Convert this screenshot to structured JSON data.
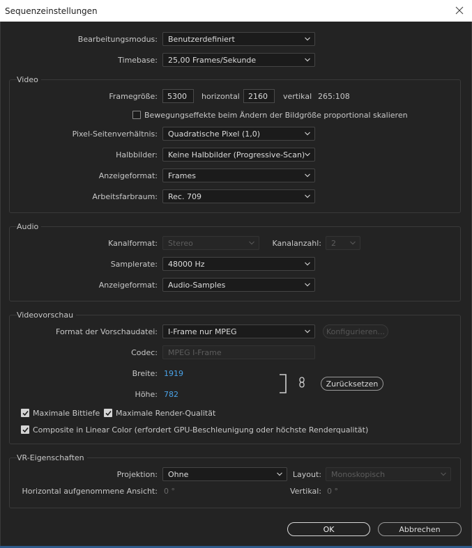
{
  "window": {
    "title": "Sequenzeinstellungen"
  },
  "general": {
    "editing_mode_label": "Bearbeitungsmodus:",
    "editing_mode_value": "Benutzerdefiniert",
    "timebase_label": "Timebase:",
    "timebase_value": "25,00  Frames/Sekunde"
  },
  "video": {
    "section_title": "Video",
    "frame_size_label": "Framegröße:",
    "frame_width": "5300",
    "horizontal_label": "horizontal",
    "frame_height": "2160",
    "vertical_label": "vertikal",
    "aspect_ratio": "265:108",
    "scale_checkbox_label": "Bewegungseffekte beim Ändern der Bildgröße proportional skalieren",
    "scale_checkbox_checked": false,
    "pixel_aspect_label": "Pixel-Seitenverhältnis:",
    "pixel_aspect_value": "Quadratische Pixel (1,0)",
    "fields_label": "Halbbilder:",
    "fields_value": "Keine Halbbilder (Progressive-Scan)",
    "display_format_label": "Anzeigeformat:",
    "display_format_value": "Frames",
    "working_color_label": "Arbeitsfarbraum:",
    "working_color_value": "Rec. 709"
  },
  "audio": {
    "section_title": "Audio",
    "channel_format_label": "Kanalformat:",
    "channel_format_value": "Stereo",
    "channel_count_label": "Kanalanzahl:",
    "channel_count_value": "2",
    "sample_rate_label": "Samplerate:",
    "sample_rate_value": "48000 Hz",
    "display_format_label": "Anzeigeformat:",
    "display_format_value": "Audio-Samples"
  },
  "preview": {
    "section_title": "Videovorschau",
    "file_format_label": "Format der Vorschaudatei:",
    "file_format_value": "I-Frame nur MPEG",
    "configure_label": "Konfigurieren...",
    "codec_label": "Codec:",
    "codec_value": "MPEG I-Frame",
    "width_label": "Breite:",
    "width_value": "1919",
    "height_label": "Höhe:",
    "height_value": "782",
    "reset_label": "Zurücksetzen",
    "max_bit_depth_label": "Maximale Bittiefe",
    "max_bit_depth_checked": true,
    "max_render_label": "Maximale Render-Qualität",
    "max_render_checked": true,
    "linear_color_label": "Composite in Linear Color (erfordert GPU-Beschleunigung oder höchste Renderqualität)",
    "linear_color_checked": true
  },
  "vr": {
    "section_title": "VR-Eigenschaften",
    "projection_label": "Projektion:",
    "projection_value": "Ohne",
    "layout_label": "Layout:",
    "layout_value": "Monoskopisch",
    "horizontal_view_label": "Horizontal aufgenommene Ansicht:",
    "horizontal_view_value": "0 °",
    "vertical_label": "Vertikal:",
    "vertical_value": "0 °"
  },
  "buttons": {
    "ok": "OK",
    "cancel": "Abbrechen"
  },
  "colors": {
    "background": "#232323",
    "link": "#4aa3e8",
    "titlebar": "#ffffff"
  },
  "icons": [
    "close-icon",
    "chevron-down-icon",
    "link-chain-icon",
    "checkmark-icon"
  ]
}
